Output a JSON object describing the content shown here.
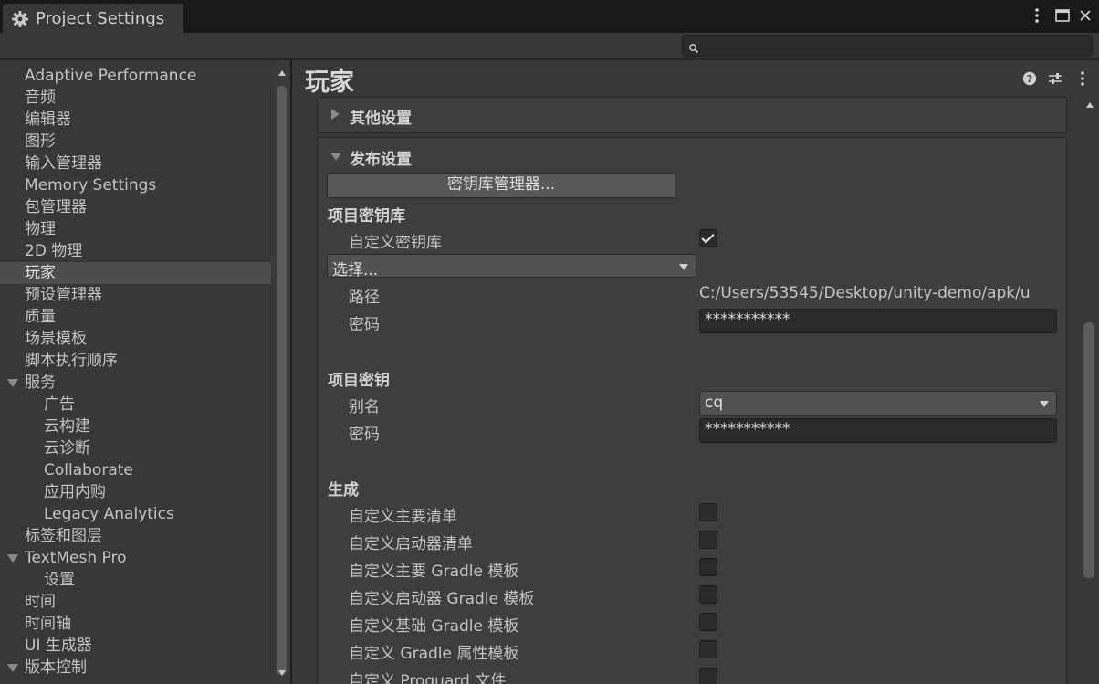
{
  "window": {
    "tab_title": "Project Settings",
    "search_placeholder": ""
  },
  "sidebar": {
    "items": [
      {
        "label": "Adaptive Performance"
      },
      {
        "label": "音频"
      },
      {
        "label": "编辑器"
      },
      {
        "label": "图形"
      },
      {
        "label": "输入管理器"
      },
      {
        "label": "Memory Settings"
      },
      {
        "label": "包管理器"
      },
      {
        "label": "物理"
      },
      {
        "label": "2D 物理"
      },
      {
        "label": "玩家",
        "selected": true
      },
      {
        "label": "预设管理器"
      },
      {
        "label": "质量"
      },
      {
        "label": "场景模板"
      },
      {
        "label": "脚本执行顺序"
      },
      {
        "label": "服务",
        "expanded": true
      },
      {
        "label": "广告"
      },
      {
        "label": "云构建"
      },
      {
        "label": "云诊断"
      },
      {
        "label": "Collaborate"
      },
      {
        "label": "应用内购"
      },
      {
        "label": "Legacy Analytics"
      },
      {
        "label": "标签和图层"
      },
      {
        "label": "TextMesh Pro",
        "expanded": true
      },
      {
        "label": "设置"
      },
      {
        "label": "时间"
      },
      {
        "label": "时间轴"
      },
      {
        "label": "UI 生成器"
      },
      {
        "label": "版本控制",
        "expanded": true
      }
    ]
  },
  "main": {
    "title": "玩家",
    "other_settings": {
      "label": "其他设置",
      "expanded": false
    },
    "publishing": {
      "label": "发布设置",
      "expanded": true,
      "keystore_manager_button": "密钥库管理器...",
      "project_keystore": {
        "heading": "项目密钥库",
        "custom_keystore_label": "自定义密钥库",
        "custom_keystore_checked": true,
        "select_value": "选择...",
        "path_label": "路径",
        "path_value": "C:/Users/53545/Desktop/unity-demo/apk/u",
        "password_label": "密码",
        "password_value": "***********"
      },
      "project_key": {
        "heading": "项目密钥",
        "alias_label": "别名",
        "alias_value": "cq",
        "password_label": "密码",
        "password_value": "***********"
      },
      "build": {
        "heading": "生成",
        "options": [
          {
            "label": "自定义主要清单",
            "checked": false
          },
          {
            "label": "自定义启动器清单",
            "checked": false
          },
          {
            "label": "自定义主要 Gradle 模板",
            "checked": false
          },
          {
            "label": "自定义启动器 Gradle 模板",
            "checked": false
          },
          {
            "label": "自定义基础 Gradle 模板",
            "checked": false
          },
          {
            "label": "自定义 Gradle 属性模板",
            "checked": false
          },
          {
            "label": "自定义 Proguard 文件",
            "checked": false
          }
        ]
      }
    }
  },
  "colors": {
    "panel": "#383838",
    "titlebar": "#191919",
    "selected": "#4d4d4d",
    "text": "#c4c4c4"
  }
}
